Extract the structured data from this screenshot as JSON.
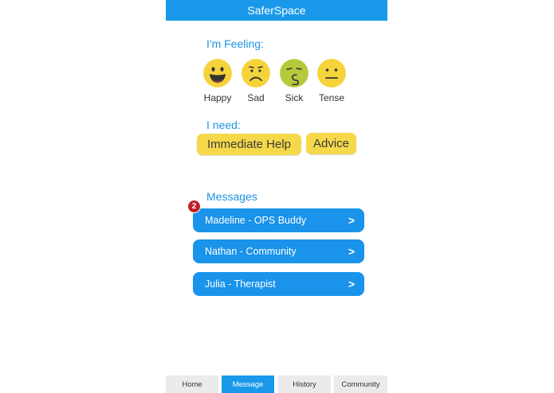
{
  "app": {
    "title": "SaferSpace"
  },
  "feeling": {
    "label": "I'm Feeling:",
    "moods": [
      {
        "label": "Happy",
        "icon": "happy-face-icon",
        "color": "#f5d33a"
      },
      {
        "label": "Sad",
        "icon": "sad-face-icon",
        "color": "#f5d33a"
      },
      {
        "label": "Sick",
        "icon": "sick-face-icon",
        "color": "#b5c93a"
      },
      {
        "label": "Tense",
        "icon": "tense-face-icon",
        "color": "#f5d33a"
      }
    ]
  },
  "need": {
    "label": "I need:",
    "buttons": [
      {
        "label": "Immediate Help"
      },
      {
        "label": "Advice"
      }
    ]
  },
  "messages": {
    "label": "Messages",
    "unread_count": "2",
    "items": [
      {
        "label": "Madeline - OPS Buddy",
        "chevron": ">"
      },
      {
        "label": "Nathan - Community",
        "chevron": ">"
      },
      {
        "label": "Julia - Therapist",
        "chevron": ">"
      }
    ]
  },
  "tabs": [
    {
      "label": "Home",
      "active": false
    },
    {
      "label": "Message",
      "active": true
    },
    {
      "label": "History",
      "active": false
    },
    {
      "label": "Community",
      "active": false
    }
  ],
  "colors": {
    "accent": "#1a99ea",
    "button_yellow": "#f5d94a",
    "badge_red": "#c0202a"
  }
}
